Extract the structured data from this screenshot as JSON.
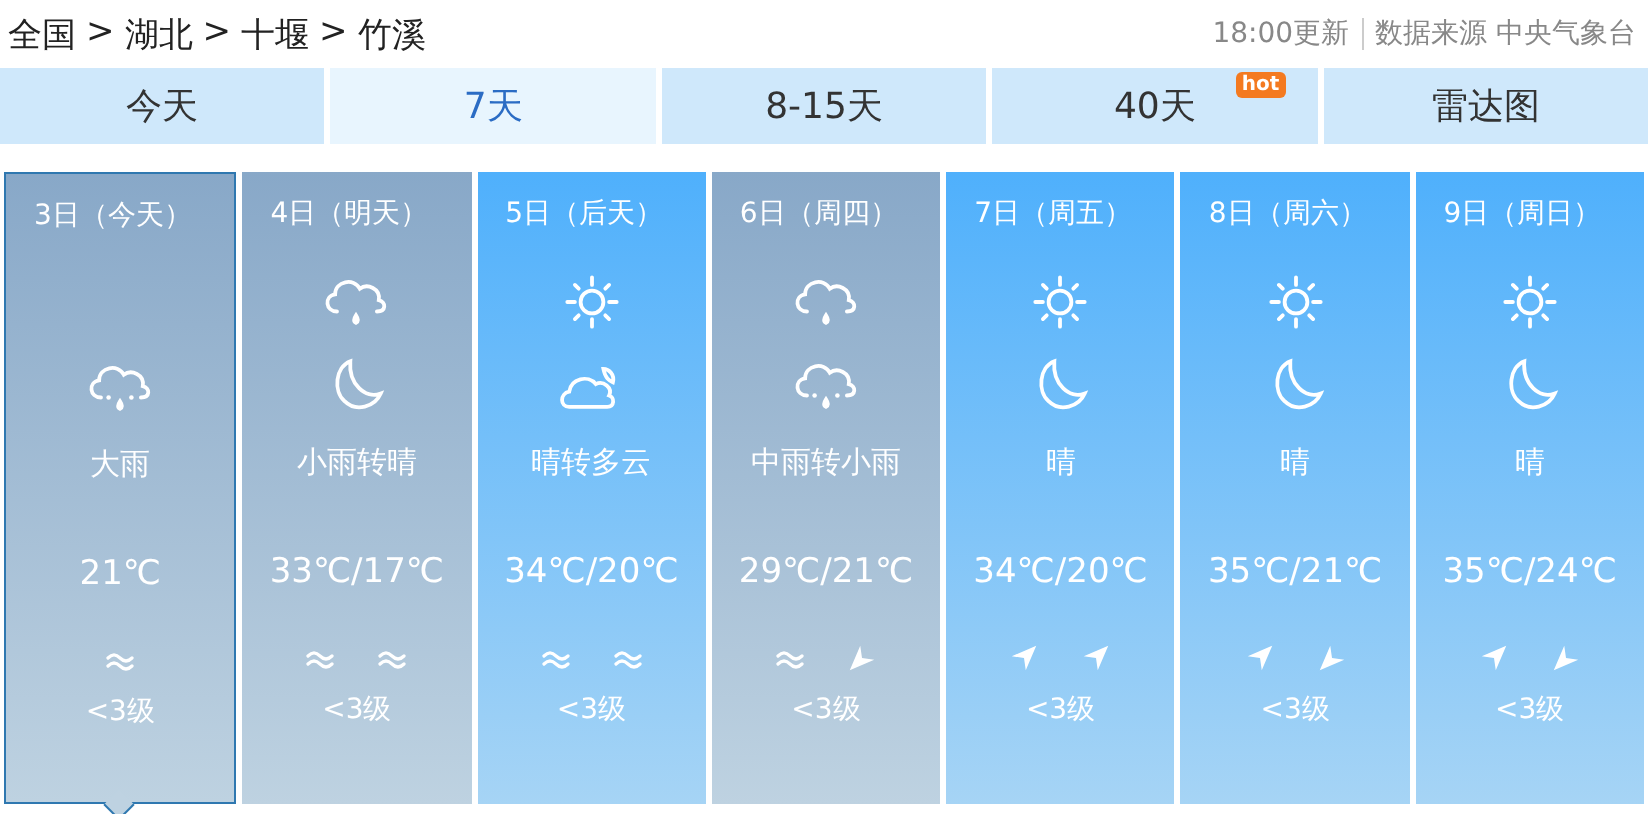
{
  "breadcrumb": {
    "separator": ">",
    "items": [
      "全国",
      "湖北",
      "十堰",
      "竹溪"
    ]
  },
  "update_time": "18:00更新",
  "source": "数据来源 中央气象台",
  "tabs": [
    {
      "label": "今天",
      "selected": false
    },
    {
      "label": "7天",
      "selected": true
    },
    {
      "label": "8-15天",
      "selected": false
    },
    {
      "label": "40天",
      "selected": false,
      "badge": "hot"
    },
    {
      "label": "雷达图",
      "selected": false
    }
  ],
  "days": [
    {
      "date": "3日（今天）",
      "selected": true,
      "kind": "rain",
      "icons": [
        {
          "kind": "rain-heavy"
        }
      ],
      "weather": "大雨",
      "temp": "21℃",
      "winds": [
        {
          "kind": "calm"
        }
      ],
      "wind_level": "<3级"
    },
    {
      "date": "4日（明天）",
      "selected": false,
      "kind": "rain",
      "icons": [
        {
          "kind": "rain"
        },
        {
          "kind": "moon"
        }
      ],
      "weather": "小雨转晴",
      "temp": "33℃/17℃",
      "winds": [
        {
          "kind": "calm"
        },
        {
          "kind": "calm"
        }
      ],
      "wind_level": "<3级"
    },
    {
      "date": "5日（后天）",
      "selected": false,
      "kind": "sunny",
      "icons": [
        {
          "kind": "sun"
        },
        {
          "kind": "cloud-moon"
        }
      ],
      "weather": "晴转多云",
      "temp": "34℃/20℃",
      "winds": [
        {
          "kind": "calm"
        },
        {
          "kind": "calm"
        }
      ],
      "wind_level": "<3级"
    },
    {
      "date": "6日（周四）",
      "selected": false,
      "kind": "rain",
      "icons": [
        {
          "kind": "rain"
        },
        {
          "kind": "rain-heavy"
        }
      ],
      "weather": "中雨转小雨",
      "temp": "29℃/21℃",
      "winds": [
        {
          "kind": "calm"
        },
        {
          "kind": "southwest"
        }
      ],
      "wind_level": "<3级"
    },
    {
      "date": "7日（周五）",
      "selected": false,
      "kind": "sunny",
      "icons": [
        {
          "kind": "sun"
        },
        {
          "kind": "moon"
        }
      ],
      "weather": "晴",
      "temp": "34℃/20℃",
      "winds": [
        {
          "kind": "northeast"
        },
        {
          "kind": "northeast"
        }
      ],
      "wind_level": "<3级"
    },
    {
      "date": "8日（周六）",
      "selected": false,
      "kind": "sunny",
      "icons": [
        {
          "kind": "sun"
        },
        {
          "kind": "moon"
        }
      ],
      "weather": "晴",
      "temp": "35℃/21℃",
      "winds": [
        {
          "kind": "northeast"
        },
        {
          "kind": "southwest"
        }
      ],
      "wind_level": "<3级"
    },
    {
      "date": "9日（周日）",
      "selected": false,
      "kind": "sunny",
      "icons": [
        {
          "kind": "sun"
        },
        {
          "kind": "moon"
        }
      ],
      "weather": "晴",
      "temp": "35℃/24℃",
      "winds": [
        {
          "kind": "northeast"
        },
        {
          "kind": "southwest"
        }
      ],
      "wind_level": "<3级"
    }
  ]
}
